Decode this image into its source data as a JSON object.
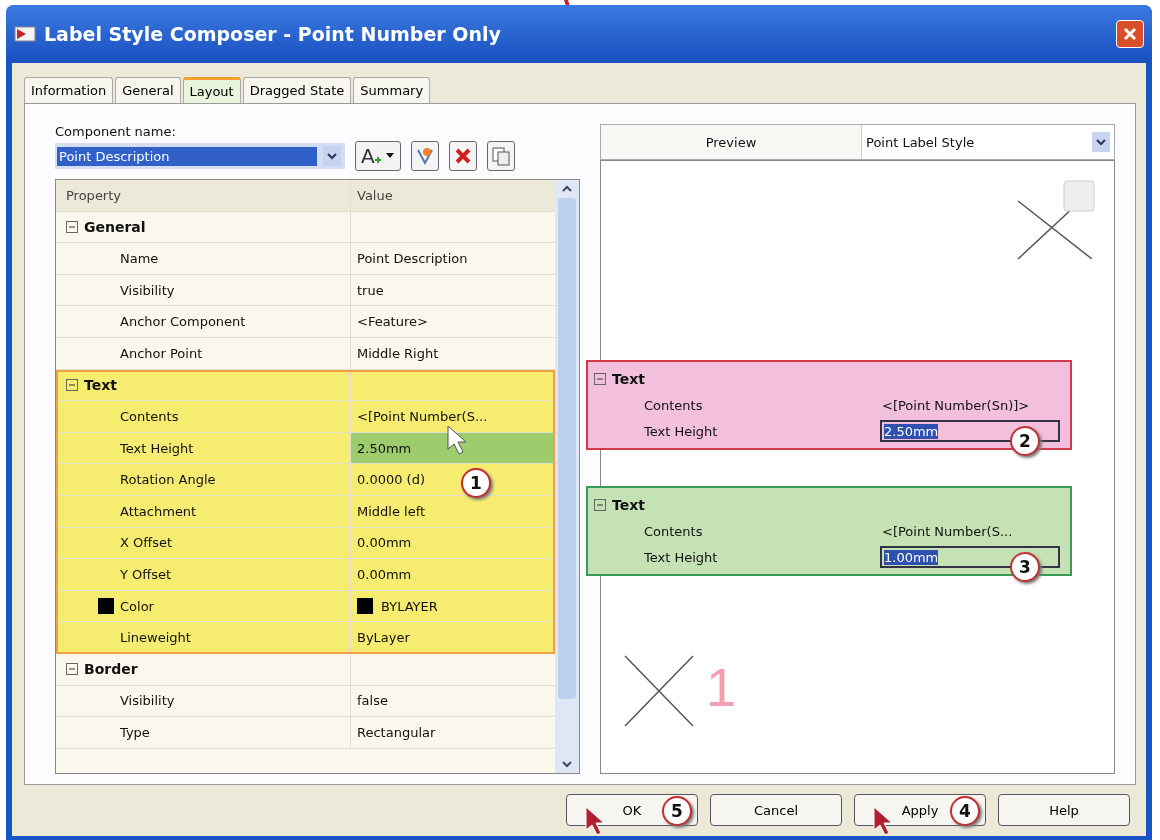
{
  "window": {
    "title": "Label Style Composer - Point Number Only"
  },
  "tabs": [
    {
      "label": "Information",
      "selected": false
    },
    {
      "label": "General",
      "selected": false
    },
    {
      "label": "Layout",
      "selected": true
    },
    {
      "label": "Dragged State",
      "selected": false
    },
    {
      "label": "Summary",
      "selected": false
    }
  ],
  "component": {
    "label": "Component name:",
    "value": "Point Description",
    "text_tool_glyph": "A"
  },
  "grid": {
    "columns": [
      "Property",
      "Value"
    ],
    "callout": "1",
    "groups": [
      {
        "label": "General",
        "expanded": true,
        "highlighted": false,
        "children": [
          {
            "kind": "text",
            "property": "Name",
            "value": "Point Description",
            "selected": false
          },
          {
            "kind": "text",
            "property": "Visibility",
            "value": "true",
            "selected": false
          },
          {
            "kind": "text",
            "property": "Anchor Component",
            "value": "<Feature>",
            "selected": false
          },
          {
            "kind": "text",
            "property": "Anchor Point",
            "value": "Middle Right",
            "selected": false
          }
        ]
      },
      {
        "label": "Text",
        "expanded": true,
        "highlighted": true,
        "children": [
          {
            "kind": "text",
            "property": "Contents",
            "value": "<[Point Number(S...",
            "selected": false
          },
          {
            "kind": "text",
            "property": "Text Height",
            "value": "2.50mm",
            "selected": true
          },
          {
            "kind": "text",
            "property": "Rotation Angle",
            "value": "0.0000 (d)",
            "selected": false
          },
          {
            "kind": "text",
            "property": "Attachment",
            "value": "Middle left",
            "selected": false
          },
          {
            "kind": "text",
            "property": "X Offset",
            "value": "0.00mm",
            "selected": false
          },
          {
            "kind": "text",
            "property": "Y Offset",
            "value": "0.00mm",
            "selected": false
          },
          {
            "kind": "color",
            "property": "Color",
            "value": "BYLAYER",
            "selected": false
          },
          {
            "kind": "text",
            "property": "Lineweight",
            "value": "ByLayer",
            "selected": false
          }
        ]
      },
      {
        "label": "Border",
        "expanded": true,
        "highlighted": false,
        "children": [
          {
            "kind": "text",
            "property": "Visibility",
            "value": "false",
            "selected": false
          },
          {
            "kind": "text",
            "property": "Type",
            "value": "Rectangular",
            "selected": false
          }
        ]
      }
    ]
  },
  "preview": {
    "header": "Preview",
    "style": "Point Label Style",
    "point_label": "1",
    "insets": [
      {
        "color": "#f2bfdc",
        "title": "Text",
        "callout": "2",
        "rows": [
          {
            "property": "Contents",
            "value": "<[Point Number(Sn)]>",
            "editing": false
          },
          {
            "property": "Text Height",
            "value": "2.50mm",
            "editing": true
          }
        ]
      },
      {
        "color": "#c4e2b4",
        "title": "Text",
        "callout": "3",
        "rows": [
          {
            "property": "Contents",
            "value": "<[Point Number(S...",
            "editing": false
          },
          {
            "property": "Text Height",
            "value": "1.00mm",
            "editing": true
          }
        ]
      }
    ]
  },
  "buttons": [
    {
      "label": "OK",
      "callout": "5",
      "cursor": true
    },
    {
      "label": "Cancel",
      "cursor": false
    },
    {
      "label": "Apply",
      "callout": "4",
      "cursor": true
    },
    {
      "label": "Help",
      "cursor": false
    }
  ]
}
